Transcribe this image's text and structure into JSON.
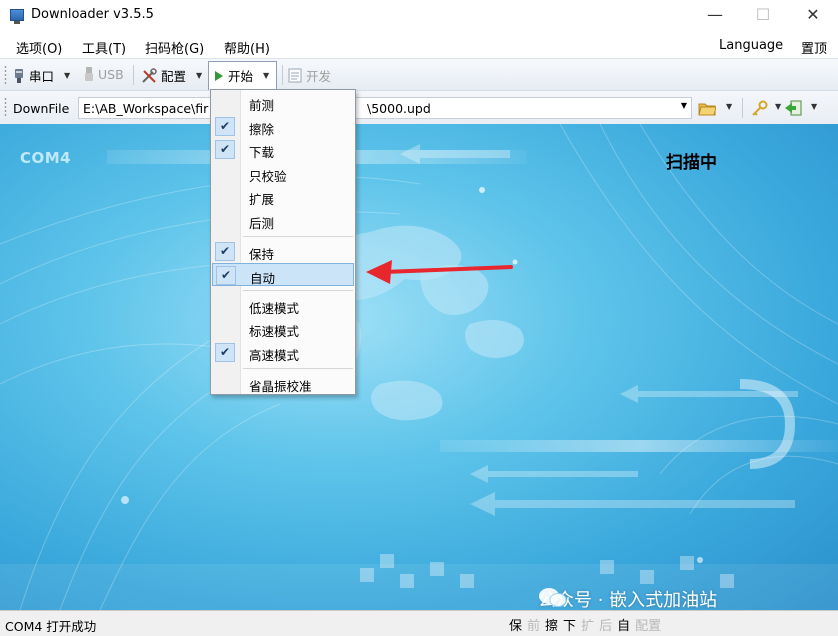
{
  "window": {
    "title": "Downloader v3.5.5",
    "minimize": "—",
    "maximize": "☐",
    "close": "✕"
  },
  "menu": {
    "items": [
      "选项(O)",
      "工具(T)",
      "扫码枪(G)",
      "帮助(H)"
    ],
    "language": "Language",
    "pin": "置顶"
  },
  "toolbar": {
    "serial": "串口",
    "usb": "USB",
    "config": "配置",
    "start": "开始",
    "develop": "开发"
  },
  "download": {
    "label": "DownFile",
    "path": "E:\\AB_Workspace\\fir",
    "path_tail": "\\5000.upd"
  },
  "banner": {
    "port": "COM4",
    "scan_status": "扫描中",
    "watermark": "公众号 · 嵌入式加油站"
  },
  "start_menu": {
    "groups": [
      [
        {
          "label": "前测",
          "checked": false
        },
        {
          "label": "擦除",
          "checked": true
        },
        {
          "label": "下载",
          "checked": true
        },
        {
          "label": "只校验",
          "checked": false
        },
        {
          "label": "扩展",
          "checked": false
        },
        {
          "label": "后测",
          "checked": false
        }
      ],
      [
        {
          "label": "保持",
          "checked": true
        },
        {
          "label": "自动",
          "checked": true,
          "highlighted": true
        }
      ],
      [
        {
          "label": "低速模式",
          "checked": false
        },
        {
          "label": "标速模式",
          "checked": false
        },
        {
          "label": "高速模式",
          "checked": true
        }
      ],
      [
        {
          "label": "省晶振校准",
          "checked": false
        }
      ]
    ],
    "check_glyph": "✔"
  },
  "status": {
    "text": "COM4 打开成功",
    "flags": [
      {
        "label": "保",
        "active": true
      },
      {
        "label": "前",
        "active": false
      },
      {
        "label": "擦",
        "active": true
      },
      {
        "label": "下",
        "active": true
      },
      {
        "label": "扩",
        "active": false
      },
      {
        "label": "后",
        "active": false
      },
      {
        "label": "自",
        "active": true
      },
      {
        "label": "配置",
        "active": false
      }
    ]
  },
  "colors": {
    "accent_red": "#e8262d",
    "banner_blue": "#3aa8dc"
  }
}
